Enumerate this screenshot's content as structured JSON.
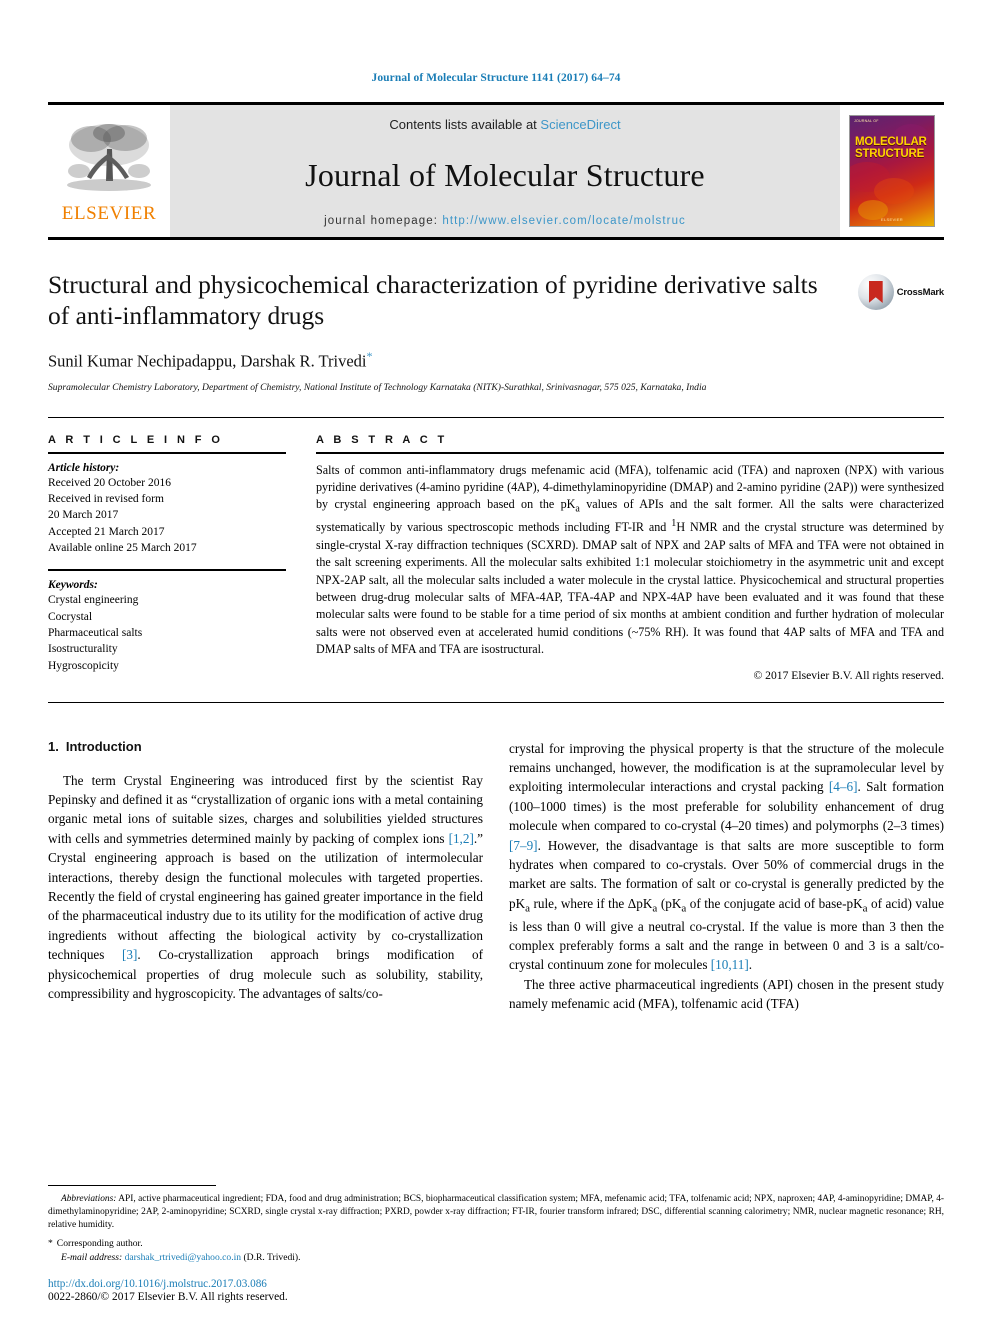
{
  "running_head": "Journal of Molecular Structure 1141 (2017) 64–74",
  "masthead": {
    "contents_prefix": "Contents lists available at ",
    "sciencedirect": "ScienceDirect",
    "journal_name": "Journal of Molecular Structure",
    "homepage_label": "journal homepage: ",
    "homepage_url": "http://www.elsevier.com/locate/molstruc",
    "publisher_logo_text": "ELSEVIER",
    "cover": {
      "top_small": "JOURNAL OF",
      "title_line1": "MOLECULAR",
      "title_line2": "STRUCTURE",
      "bottom_small": "ELSEVIER"
    }
  },
  "article": {
    "title": "Structural and physicochemical characterization of pyridine derivative salts of anti-inflammatory drugs",
    "authors": "Sunil Kumar Nechipadappu, Darshak R. Trivedi",
    "author_star": "*",
    "affiliation": "Supramolecular Chemistry Laboratory, Department of Chemistry, National Institute of Technology Karnataka (NITK)-Surathkal, Srinivasnagar, 575 025, Karnataka, India",
    "crossmark_label": "CrossMark"
  },
  "article_info": {
    "heading": "A R T I C L E  I N F O",
    "history_label": "Article history:",
    "history": [
      "Received 20 October 2016",
      "Received in revised form",
      "20 March 2017",
      "Accepted 21 March 2017",
      "Available online 25 March 2017"
    ],
    "keywords_label": "Keywords:",
    "keywords": [
      "Crystal engineering",
      "Cocrystal",
      "Pharmaceutical salts",
      "Isostructurality",
      "Hygroscopicity"
    ]
  },
  "abstract": {
    "heading": "A B S T R A C T",
    "text": "Salts of common anti-inflammatory drugs mefenamic acid (MFA), tolfenamic acid (TFA) and naproxen (NPX) with various pyridine derivatives (4-amino pyridine (4AP), 4-dimethylaminopyridine (DMAP) and 2-amino pyridine (2AP)) were synthesized by crystal engineering approach based on the pKa values of APIs and the salt former. All the salts were characterized systematically by various spectroscopic methods including FT-IR and 1H NMR and the crystal structure was determined by single-crystal X-ray diffraction techniques (SCXRD). DMAP salt of NPX and 2AP salts of MFA and TFA were not obtained in the salt screening experiments. All the molecular salts exhibited 1:1 molecular stoichiometry in the asymmetric unit and except NPX-2AP salt, all the molecular salts included a water molecule in the crystal lattice. Physicochemical and structural properties between drug-drug molecular salts of MFA-4AP, TFA-4AP and NPX-4AP have been evaluated and it was found that these molecular salts were found to be stable for a time period of six months at ambient condition and further hydration of molecular salts were not observed even at accelerated humid conditions (~75% RH). It was found that 4AP salts of MFA and TFA and DMAP salts of MFA and TFA are isostructural.",
    "copyright": "© 2017 Elsevier B.V. All rights reserved."
  },
  "introduction": {
    "number": "1.",
    "heading": "Introduction",
    "left_paragraph_part1": "The term Crystal Engineering was introduced first by the scientist Ray Pepinsky and defined it as “crystallization of organic ions with a metal containing organic metal ions of suitable sizes, charges and solubilities yielded structures with cells and symmetries determined mainly by packing of complex ions ",
    "ref_1_2": "[1,2]",
    "left_paragraph_part2": ".” Crystal engineering approach is based on the utilization of intermolecular interactions, thereby design the functional molecules with targeted properties. Recently the field of crystal engineering has gained greater importance in the field of the pharmaceutical industry due to its utility for the modification of active drug ingredients without affecting the biological activity by co-crystallization techniques ",
    "ref_3": "[3]",
    "left_paragraph_part3": ". Co-crystallization approach brings modification of physicochemical properties of drug molecule such as solubility, stability, compressibility and hygroscopicity. The advantages of salts/co-",
    "right_paragraph_part1": "crystal for improving the physical property is that the structure of the molecule remains unchanged, however, the modification is at the supramolecular level by exploiting intermolecular interactions and crystal packing ",
    "ref_4_6": "[4–6]",
    "right_paragraph_part2": ". Salt formation (100–1000 times) is the most preferable for solubility enhancement of drug molecule when compared to co-crystal (4–20 times) and polymorphs (2–3 times) ",
    "ref_7_9": "[7–9]",
    "right_paragraph_part3": ". However, the disadvantage is that salts are more susceptible to form hydrates when compared to co-crystals. Over 50% of commercial drugs in the market are salts. The formation of salt or co-crystal is generally predicted by the pKa rule, where if the ΔpKa (pKa of the conjugate acid of base-pKa of acid) value is less than 0 will give a neutral co-crystal. If the value is more than 3 then the complex preferably forms a salt and the range in between 0 and 3 is a salt/co-crystal continuum zone for molecules ",
    "ref_10_11": "[10,11]",
    "right_paragraph_part4": ".",
    "right_paragraph2": "The three active pharmaceutical ingredients (API) chosen in the present study namely mefenamic acid (MFA), tolfenamic acid (TFA)"
  },
  "footnotes": {
    "abbreviations_label": "Abbreviations:",
    "abbreviations_text": " API, active pharmaceutical ingredient; FDA, food and drug administration; BCS, biopharmaceutical classification system; MFA, mefenamic acid; TFA, tolfenamic acid; NPX, naproxen; 4AP, 4-aminopyridine; DMAP, 4-dimethylaminopyridine; 2AP, 2-aminopyridine; SCXRD, single crystal x-ray diffraction; PXRD, powder x-ray diffraction; FT-IR, fourier transform infrared; DSC, differential scanning calorimetry; NMR, nuclear magnetic resonance; RH, relative humidity.",
    "corresponding_bullet": "*",
    "corresponding_author": "Corresponding author.",
    "email_label": "E-mail address:",
    "email": "darshak_rtrivedi@yahoo.co.in",
    "email_suffix": "(D.R. Trivedi).",
    "doi_url": "http://dx.doi.org/10.1016/j.molstruc.2017.03.086",
    "issn_line": "0022-2860/© 2017 Elsevier B.V. All rights reserved."
  }
}
